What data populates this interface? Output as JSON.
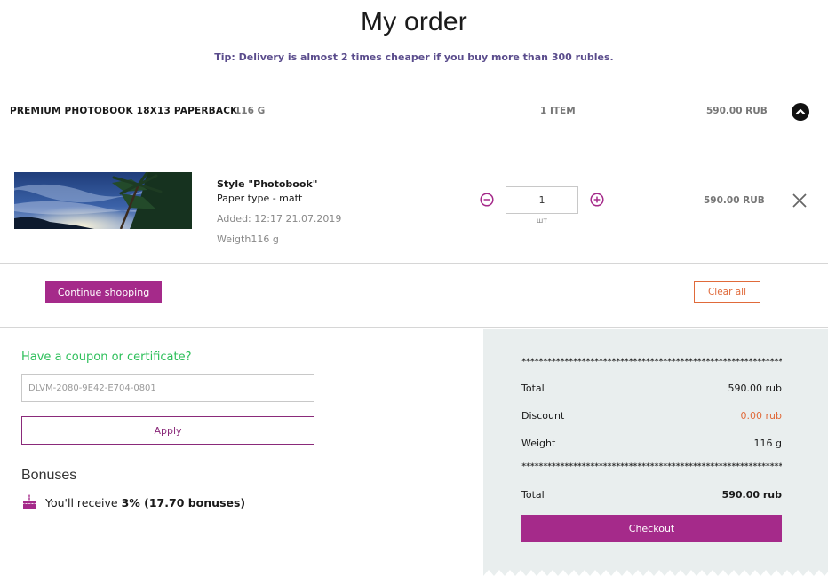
{
  "page": {
    "title": "My order",
    "tip": "Tip: Delivery is almost 2 times cheaper if you buy more than 300 rubles."
  },
  "group": {
    "name": "PREMIUM PHOTOBOOK 18X13 PAPERBACK",
    "weight": "116 G",
    "count": "1 ITEM",
    "price": "590.00 RUB",
    "collapse_icon": "chevron-up-icon"
  },
  "item": {
    "style": "Style \"Photobook\"",
    "paper": "Paper type - matt",
    "added": "Added: 12:17 21.07.2019",
    "weight": "Weigth116 g",
    "quantity": "1",
    "unit": "шт",
    "price": "590.00 RUB",
    "thumbnail": "night-sky-palm-tree-photo"
  },
  "actions": {
    "continue": "Continue shopping",
    "clear": "Clear all"
  },
  "coupon": {
    "title": "Have a coupon or certificate?",
    "placeholder": "DLVM-2080-9E42-E704-0801",
    "apply": "Apply"
  },
  "bonuses": {
    "title": "Bonuses",
    "prefix": "You'll receive ",
    "amount": "3% (17.70 bonuses)"
  },
  "summary": {
    "stars": "***************************************************************",
    "total_label": "Total",
    "total_value": "590.00 rub",
    "discount_label": "Discount",
    "discount_value": "0.00 rub",
    "weight_label": "Weight",
    "weight_value": "116 g",
    "grand_label": "Total",
    "grand_value": "590.00 rub",
    "checkout": "Checkout"
  },
  "colors": {
    "accent": "#a52a8a",
    "tip": "#5a4c8c",
    "coupon_title": "#2dbf5a",
    "clear_discount": "#e06a3a",
    "summary_bg": "#e9eeee"
  }
}
